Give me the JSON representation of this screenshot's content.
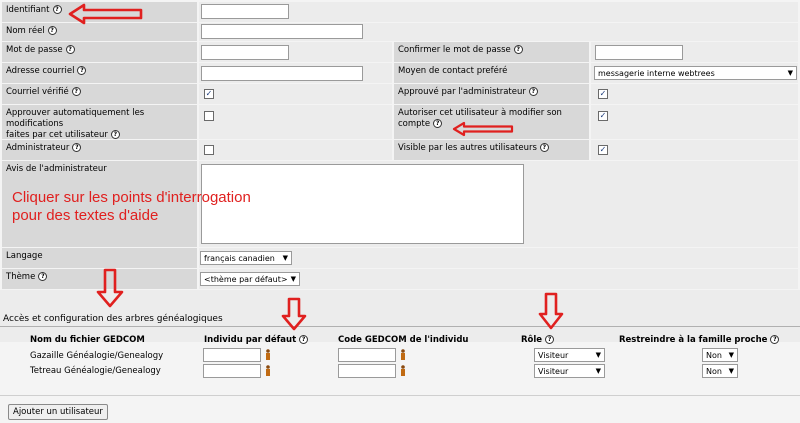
{
  "fields": {
    "identifiant": "Identifiant",
    "nom_reel": "Nom réel",
    "mot_de_passe": "Mot de passe",
    "confirmer": "Confirmer le mot de passe",
    "adresse": "Adresse courriel",
    "moyen": "Moyen de contact preféré",
    "moyen_value": "messagerie interne webtrees",
    "courriel_verifie": "Courriel vérifié",
    "approuve": "Approuvé par l'administrateur",
    "approuver_auto_1": "Approuver automatiquement les modifications",
    "approuver_auto_2": "faites par cet utilisateur",
    "autoriser_1": "Autoriser cet utilisateur à modifier son",
    "autoriser_2": "compte",
    "administrateur": "Administrateur",
    "visible": "Visible par les autres utilisateurs",
    "avis": "Avis de l'administrateur",
    "langage": "Langage",
    "langage_value": "français canadien",
    "theme": "Thème",
    "theme_value": "<thème par défaut>"
  },
  "help_note": {
    "line1": "Cliquer sur les points d'interrogation",
    "line2": "pour des textes d'aide"
  },
  "trees": {
    "section_title": "Accès et configuration des arbres généalogiques",
    "headers": {
      "file": "Nom du fichier GEDCOM",
      "default_individual": "Individu par défaut",
      "gedcom_code": "Code GEDCOM de l'individu",
      "role": "Rôle",
      "restrict": "Restreindre à la famille proche"
    },
    "rows": [
      {
        "name": "Gazaille Généalogie/Genealogy",
        "role": "Visiteur",
        "restrict": "Non"
      },
      {
        "name": "Tetreau Généalogie/Genealogy",
        "role": "Visiteur",
        "restrict": "Non"
      }
    ]
  },
  "add_user_label": "Ajouter un utilisateur",
  "help_glyph": "?",
  "check_glyph": "✓",
  "colors": {
    "annotation_red": "#e0201f",
    "label_bg": "#d8d8d8",
    "value_bg": "#ececec"
  }
}
